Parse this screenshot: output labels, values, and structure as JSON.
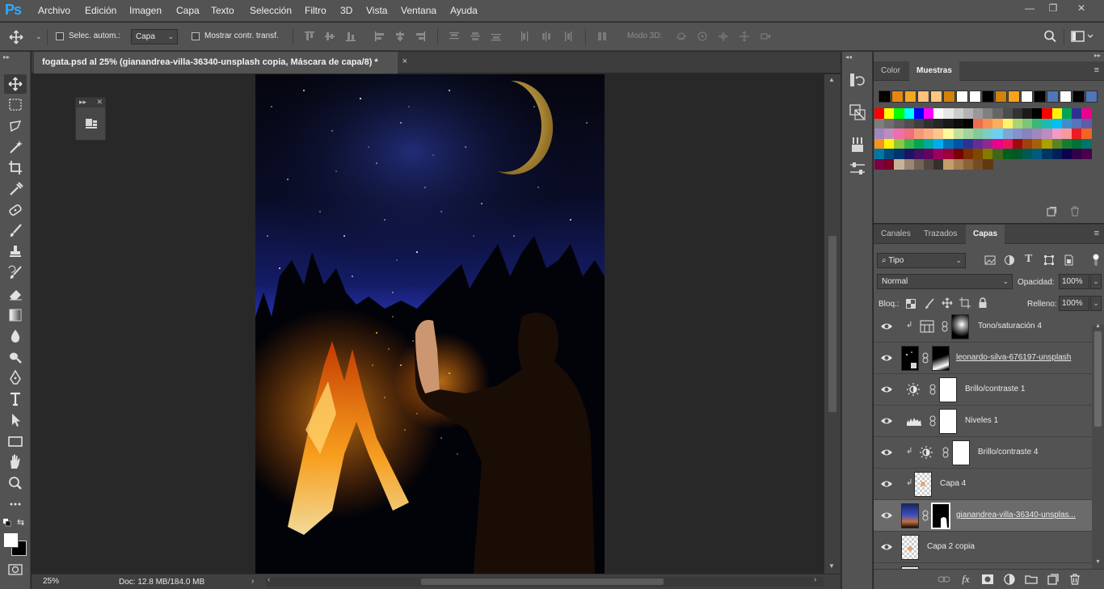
{
  "app": {
    "logo": "Ps"
  },
  "menu": [
    "Archivo",
    "Edición",
    "Imagen",
    "Capa",
    "Texto",
    "Selección",
    "Filtro",
    "3D",
    "Vista",
    "Ventana",
    "Ayuda"
  ],
  "window_controls": {
    "minimize": "—",
    "restore": "❐",
    "close": "✕"
  },
  "options_bar": {
    "auto_select_label": "Selec. autom.:",
    "auto_select_target": "Capa",
    "show_transform_label": "Mostrar contr. transf.",
    "mode3d_label": "Modo 3D:"
  },
  "document": {
    "tab_title": "fogata.psd al 25% (gianandrea-villa-36340-unsplash copia, Máscara de capa/8) *",
    "close": "×"
  },
  "status": {
    "zoom": "25%",
    "doc_size": "Doc: 12.8 MB/184.0 MB"
  },
  "swatches_panel": {
    "tabs": [
      "Color",
      "Muestras"
    ],
    "active_tab": "Muestras",
    "recent": [
      "#000000",
      "#e8850c",
      "#f5a623",
      "#ffc278",
      "#ffc57d",
      "#d0820a",
      "#ffffff",
      "#ffffff",
      "#000000",
      "#d0820a",
      "#f9a21b",
      "#ffffff",
      "#000000",
      "#4f76b8",
      "#ffffff",
      "#000000",
      "#4f76b8"
    ],
    "rows": [
      [
        "#ff0000",
        "#ffff00",
        "#00ff00",
        "#00ffff",
        "#0000ff",
        "#ff00ff",
        "#ffffff",
        "#e6e6e6",
        "#cccccc",
        "#b3b3b3",
        "#999999",
        "#808080",
        "#666666",
        "#4d4d4d",
        "#333333",
        "#1a1a1a",
        "#000000",
        "#ff0000",
        "#fff200",
        "#00a651",
        "#2e3192",
        "#ec008c"
      ],
      [
        "#7d7d7d",
        "#6e6e6e",
        "#5e5e5e",
        "#4f4f4f",
        "#404040",
        "#303030",
        "#262626",
        "#1a1a1a",
        "#0d0d0d",
        "#000000",
        "#f26c4f",
        "#f68e56",
        "#fbaf5c",
        "#fff467",
        "#acd372",
        "#7cc576",
        "#3bb878",
        "#1abbb4",
        "#00bff3",
        "#438ccb",
        "#5574b9",
        "#605ca8"
      ],
      [
        "#a186be",
        "#bd8cbf",
        "#f06ea9",
        "#f26d7d",
        "#f7977a",
        "#f9ad81",
        "#fdc68a",
        "#fff79a",
        "#c4df9b",
        "#a3d39c",
        "#82ca9d",
        "#7bcdc8",
        "#6ecff6",
        "#7ea7d8",
        "#8493ca",
        "#8882be",
        "#a187be",
        "#bc8dbf",
        "#f49ac2",
        "#f6989d",
        "#ed1c24",
        "#f26522"
      ],
      [
        "#f7941d",
        "#fff200",
        "#8dc63f",
        "#39b54a",
        "#00a651",
        "#00a99d",
        "#00aeef",
        "#0072bc",
        "#0054a6",
        "#2e3192",
        "#662d91",
        "#92278f",
        "#ec008c",
        "#ed145b",
        "#9e0b0f",
        "#a0410d",
        "#a36209",
        "#aba000",
        "#598527",
        "#1a7b30",
        "#007236",
        "#00746b"
      ],
      [
        "#0076a3",
        "#004b80",
        "#003471",
        "#1b1464",
        "#440e62",
        "#630460",
        "#9e005d",
        "#9e0039",
        "#790000",
        "#7b2e00",
        "#7d4900",
        "#827b00",
        "#406618",
        "#005e20",
        "#005826",
        "#005952",
        "#005b7f",
        "#003663",
        "#002157",
        "#0d004c",
        "#32004b",
        "#4b0049"
      ],
      [
        "#7b0046",
        "#7a0026",
        "#c7b299",
        "#998675",
        "#736357",
        "#534741",
        "#37302a",
        "#c69c6d",
        "#a67c52",
        "#8c6239",
        "#754c24",
        "#603913"
      ]
    ]
  },
  "layers_panel": {
    "tabs": [
      "Canales",
      "Trazados",
      "Capas"
    ],
    "active_tab": "Capas",
    "filter_kind": "Tipo",
    "blend_mode": "Normal",
    "opacity_label": "Opacidad:",
    "opacity_value": "100%",
    "lock_label": "Bloq.:",
    "fill_label": "Relleno:",
    "fill_value": "100%",
    "layers": [
      {
        "name": "Tono/saturación 4",
        "kind": "hue-saturation",
        "clipped": true,
        "selected": false,
        "linked_name": false
      },
      {
        "name": "leonardo-silva-676197-unsplash",
        "kind": "image-mask",
        "clipped": false,
        "selected": false,
        "linked_name": true
      },
      {
        "name": "Brillo/contraste 1",
        "kind": "brightness",
        "clipped": false,
        "selected": false,
        "linked_name": false
      },
      {
        "name": "Niveles 1",
        "kind": "levels",
        "clipped": false,
        "selected": false,
        "linked_name": false
      },
      {
        "name": "Brillo/contraste 4",
        "kind": "brightness",
        "clipped": true,
        "selected": false,
        "linked_name": false
      },
      {
        "name": "Capa 4",
        "kind": "pixel",
        "clipped": true,
        "selected": false,
        "linked_name": false
      },
      {
        "name": "gianandrea-villa-36340-unsplas...",
        "kind": "photo-mask",
        "clipped": false,
        "selected": true,
        "linked_name": true
      },
      {
        "name": "Capa 2 copia",
        "kind": "pixel",
        "clipped": false,
        "selected": false,
        "linked_name": false
      }
    ]
  }
}
